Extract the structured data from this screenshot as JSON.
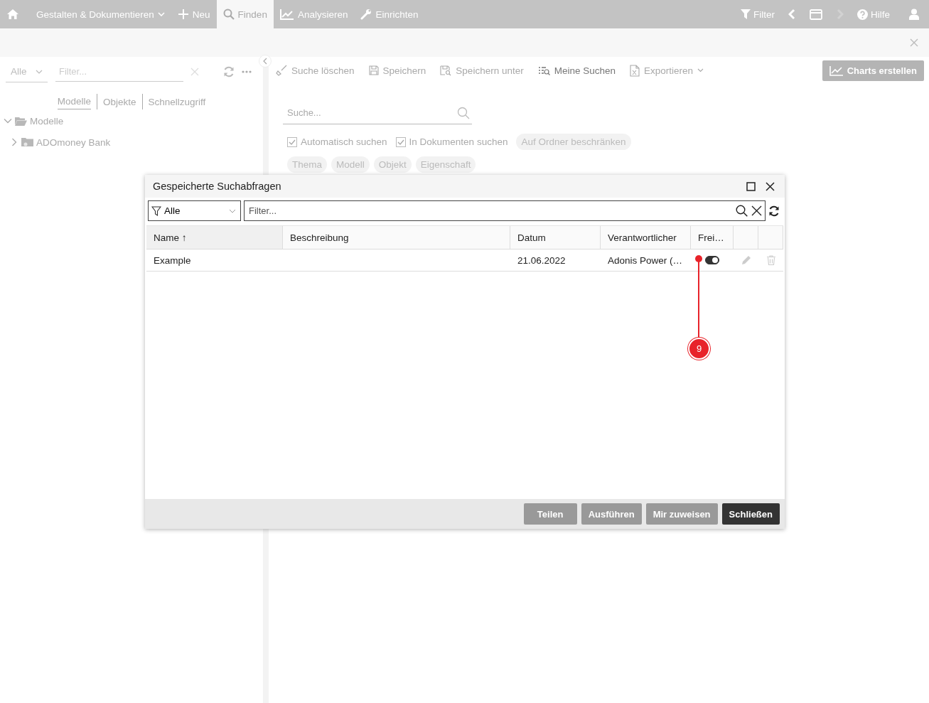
{
  "top_nav": {
    "items": [
      {
        "kind": "home",
        "selected": false
      },
      {
        "kind": "text",
        "label": "Gestalten & Dokumentieren",
        "selected": false,
        "dropdown": true
      },
      {
        "kind": "plus",
        "label": "Neu",
        "selected": false,
        "dropdown": false
      },
      {
        "kind": "search",
        "label": "Finden",
        "selected": true,
        "dropdown": false
      },
      {
        "kind": "chart",
        "label": "Analysieren",
        "selected": false,
        "dropdown": false
      },
      {
        "kind": "wrench",
        "label": "Einrichten",
        "selected": false,
        "dropdown": false
      }
    ],
    "right_items": [
      {
        "kind": "filter",
        "label": "Filter",
        "disabled": false
      },
      {
        "kind": "prev",
        "disabled": false
      },
      {
        "kind": "window",
        "disabled": false
      },
      {
        "kind": "next",
        "disabled": true
      },
      {
        "kind": "help",
        "label": "Hilfe",
        "disabled": false
      },
      {
        "kind": "user",
        "disabled": false
      }
    ]
  },
  "left_panel": {
    "scope": "Alle",
    "filter_placeholder": "Filter...",
    "tabs": [
      {
        "label": "Modelle",
        "selected": true
      },
      {
        "label": "Objekte",
        "selected": false
      },
      {
        "label": "Schnellzugriff",
        "selected": false
      }
    ],
    "tree": [
      {
        "label": "Modelle",
        "kind": "folder",
        "expanded": true,
        "children": [
          {
            "label": "ADOmoney Bank",
            "kind": "model-folder",
            "expanded": false
          }
        ]
      }
    ]
  },
  "toolbar": {
    "items": [
      {
        "kind": "broom",
        "label": "Suche löschen",
        "disabled": true
      },
      {
        "kind": "save",
        "label": "Speichern",
        "disabled": true
      },
      {
        "kind": "save-as",
        "label": "Speichern unter",
        "disabled": true
      },
      {
        "kind": "list",
        "label": "Meine Suchen",
        "disabled": false
      },
      {
        "kind": "export",
        "label": "Exportieren",
        "disabled": true
      }
    ],
    "charts_button": "Charts erstellen"
  },
  "search": {
    "placeholder": "Suche...",
    "options": [
      {
        "label": "Automatisch suchen",
        "checked": true
      },
      {
        "label": "In Dokumenten suchen",
        "checked": true
      }
    ],
    "restrict_chip": "Auf Ordner beschränken",
    "chips": [
      "Thema",
      "Modell",
      "Objekt",
      "Eigenschaft"
    ]
  },
  "dialog": {
    "title": "Gespeicherte Suchabfragen",
    "scope": "Alle",
    "filter_placeholder": "Filter...",
    "columns": [
      "Name ↑",
      "Beschreibung",
      "Datum",
      "Verantwortlicher",
      "Frei…"
    ],
    "rows": [
      {
        "name": "Example",
        "date": "21.06.2022",
        "owner": "Adonis Power (…",
        "released": true
      }
    ],
    "buttons": [
      {
        "label": "Teilen",
        "primary": false
      },
      {
        "label": "Ausführen",
        "primary": false
      },
      {
        "label": "Mir zuweisen",
        "primary": false
      },
      {
        "label": "Schließen",
        "primary": true
      }
    ]
  },
  "annotation": {
    "label": "9"
  }
}
